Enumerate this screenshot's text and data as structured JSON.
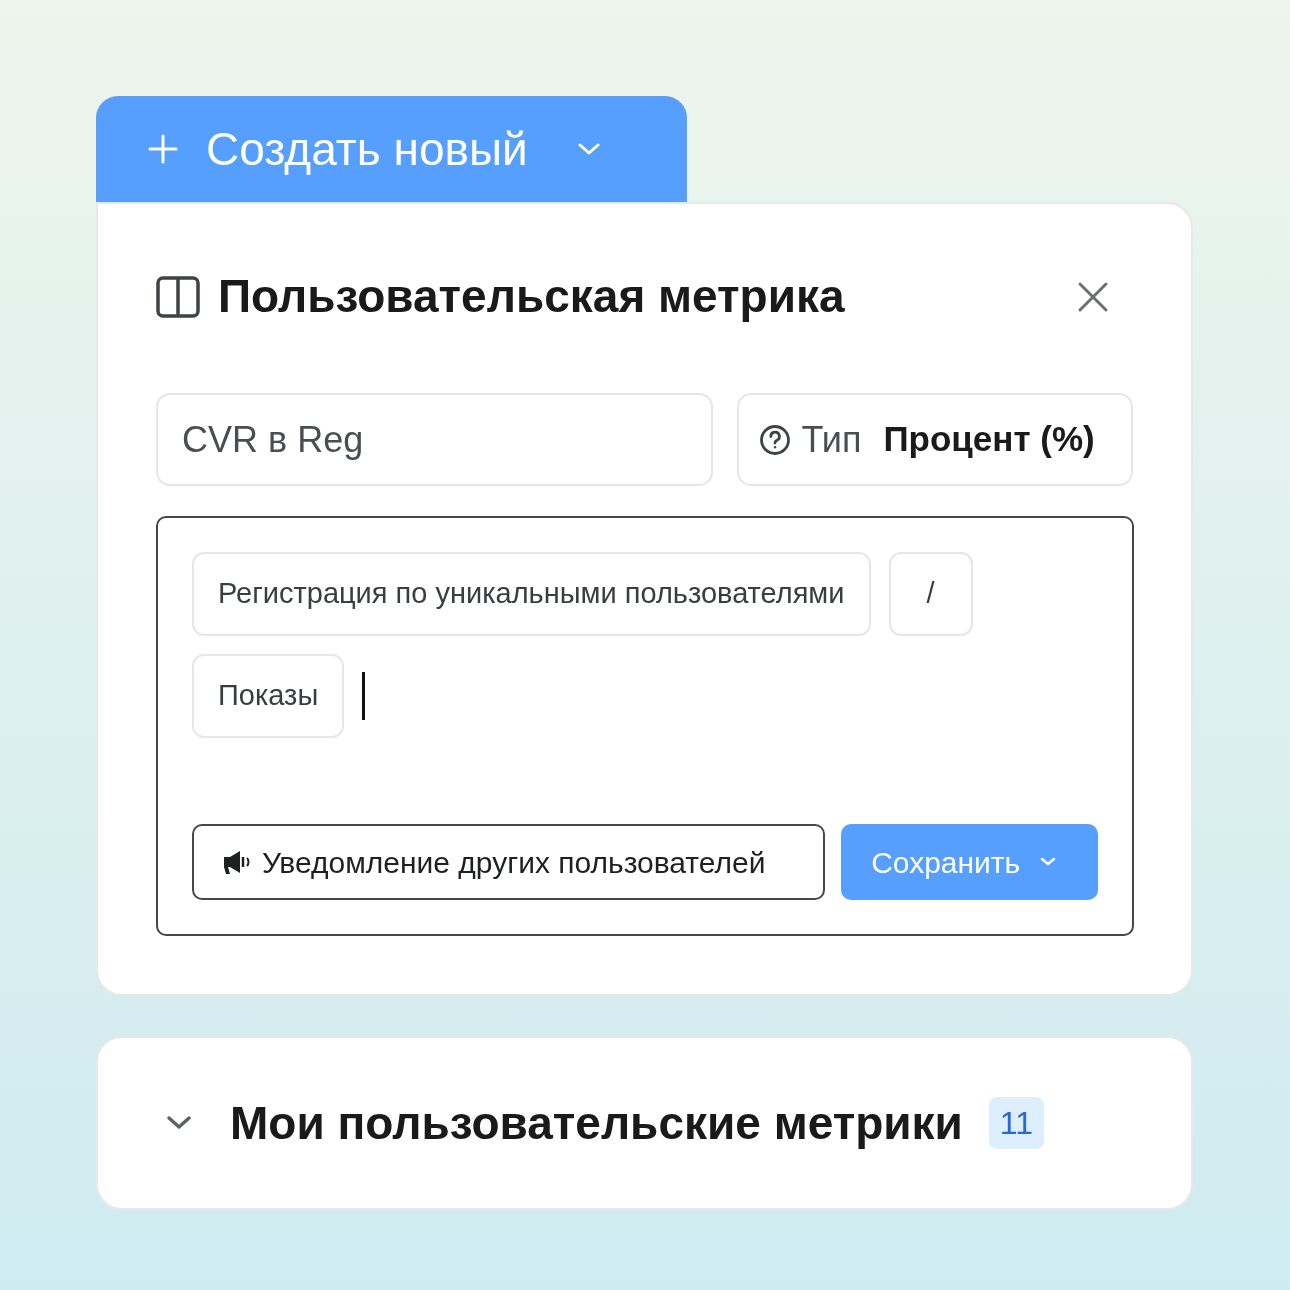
{
  "create_button": {
    "label": "Создать новый"
  },
  "dialog": {
    "title": "Пользовательская метрика",
    "name_field": {
      "value": "CVR в Reg"
    },
    "type_field": {
      "label": "Тип",
      "value": "Процент (%)"
    },
    "formula": [
      {
        "text": "Регистрация по уникальными пользователями"
      },
      {
        "text": "/"
      },
      {
        "text": "Показы"
      }
    ],
    "notify_button": {
      "label": "Уведомление других пользователей"
    },
    "save_button": {
      "label": "Сохранить"
    }
  },
  "my_metrics": {
    "title": "Мои пользовательские метрики",
    "count": "11"
  }
}
